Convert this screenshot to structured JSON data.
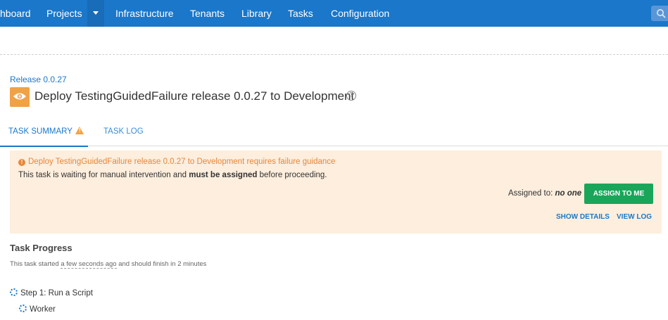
{
  "nav": {
    "items": [
      "hboard",
      "Projects",
      "Infrastructure",
      "Tenants",
      "Library",
      "Tasks",
      "Configuration"
    ],
    "dropdown_icon": "chevron-down-icon",
    "search_icon": "search-icon",
    "bar_color": "#1a77ca"
  },
  "breadcrumb": "Release 0.0.27",
  "header": {
    "title": "Deploy TestingGuidedFailure release 0.0.27 to Development",
    "icon": "eye-icon",
    "help": "?"
  },
  "tabs": [
    {
      "label": "TASK SUMMARY",
      "warning": "!"
    },
    {
      "label": "TASK LOG"
    }
  ],
  "alert": {
    "icon": "!",
    "title": "Deploy TestingGuidedFailure release 0.0.27 to Development requires failure guidance",
    "msg_pre": "This task is waiting for manual intervention and ",
    "msg_bold": "must be assigned",
    "msg_post": " before proceeding.",
    "assigned_label": "Assigned to: ",
    "assigned_value": "no one",
    "assign_button": "ASSIGN TO ME",
    "show_details": "SHOW DETAILS",
    "view_log": "VIEW LOG",
    "bg_color": "#fdeedd",
    "accent_color": "#e8863a"
  },
  "progress": {
    "heading": "Task Progress",
    "text_pre": "This task started ",
    "text_link": "a few seconds ago",
    "text_post": " and should finish in 2 minutes",
    "steps": [
      {
        "label": "Step 1: Run a Script"
      },
      {
        "label": "Worker"
      }
    ]
  },
  "accent_color": "#1a77ca",
  "button_color": "#1aa65a"
}
